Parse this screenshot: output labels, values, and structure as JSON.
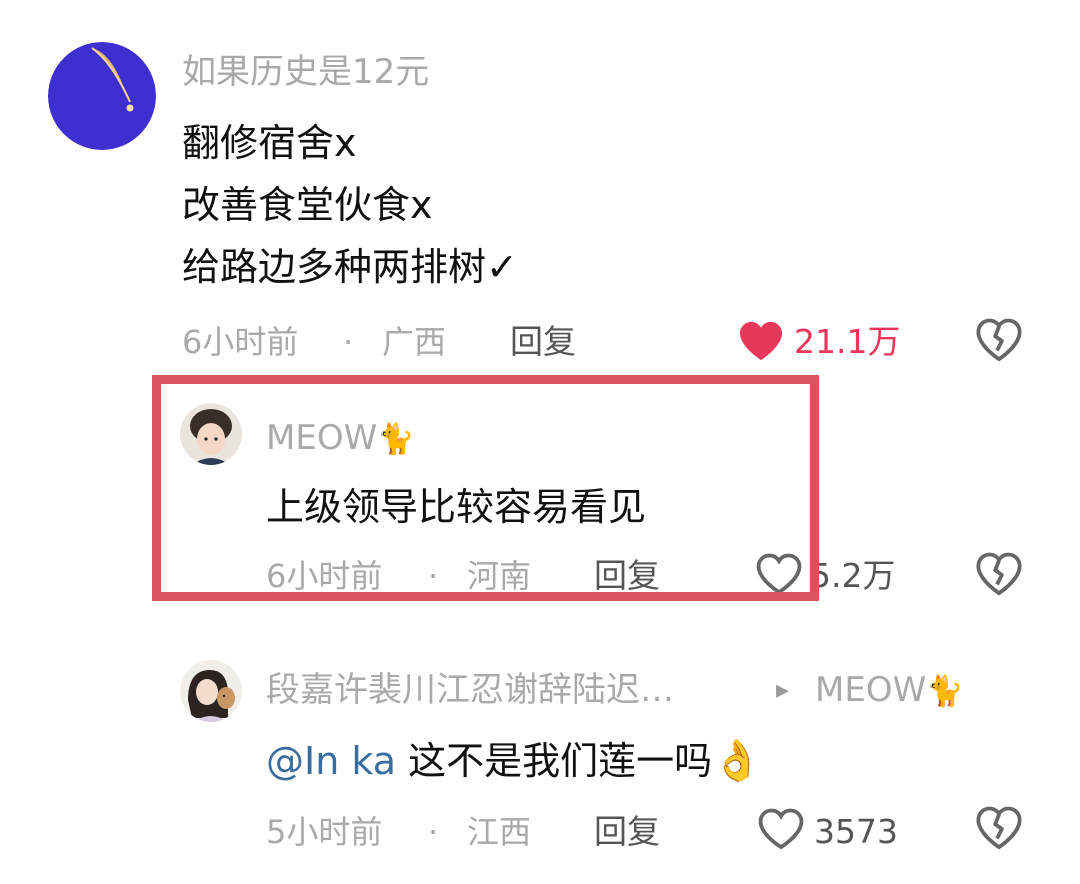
{
  "comments": [
    {
      "username": "如果历史是12元",
      "lines": [
        "翻修宿舍x",
        "改善食堂伙食x",
        "给路边多种两排树✓"
      ],
      "time": "6小时前",
      "sep": "·",
      "location": "广西",
      "reply_label": "回复",
      "likes": "21.1万",
      "liked": true
    },
    {
      "username": "MEOW",
      "username_emoji": "🐈",
      "text": "上级领导比较容易看见",
      "time": "6小时前",
      "sep": "·",
      "location": "河南",
      "reply_label": "回复",
      "likes": "5.2万",
      "liked": false,
      "highlighted": true
    },
    {
      "username": "段嘉许裴川江忍谢辞陆迟…",
      "reply_arrow": "▸",
      "reply_to": "MEOW",
      "reply_to_emoji": "🐈",
      "mention": "@In ka",
      "text": "这不是我们莲一吗",
      "text_emoji": "👌",
      "time": "5小时前",
      "sep": "·",
      "location": "江西",
      "reply_label": "回复",
      "likes": "3573",
      "liked": false
    }
  ],
  "colors": {
    "highlight_border": "#d7555e",
    "like_red": "#e8375a",
    "meta_gray": "#a9a9a9",
    "mention_blue": "#3a6d9e"
  },
  "icons": {
    "liked_heart": "heart-filled-icon",
    "heart": "heart-outline-icon",
    "dislike": "broken-heart-icon"
  }
}
